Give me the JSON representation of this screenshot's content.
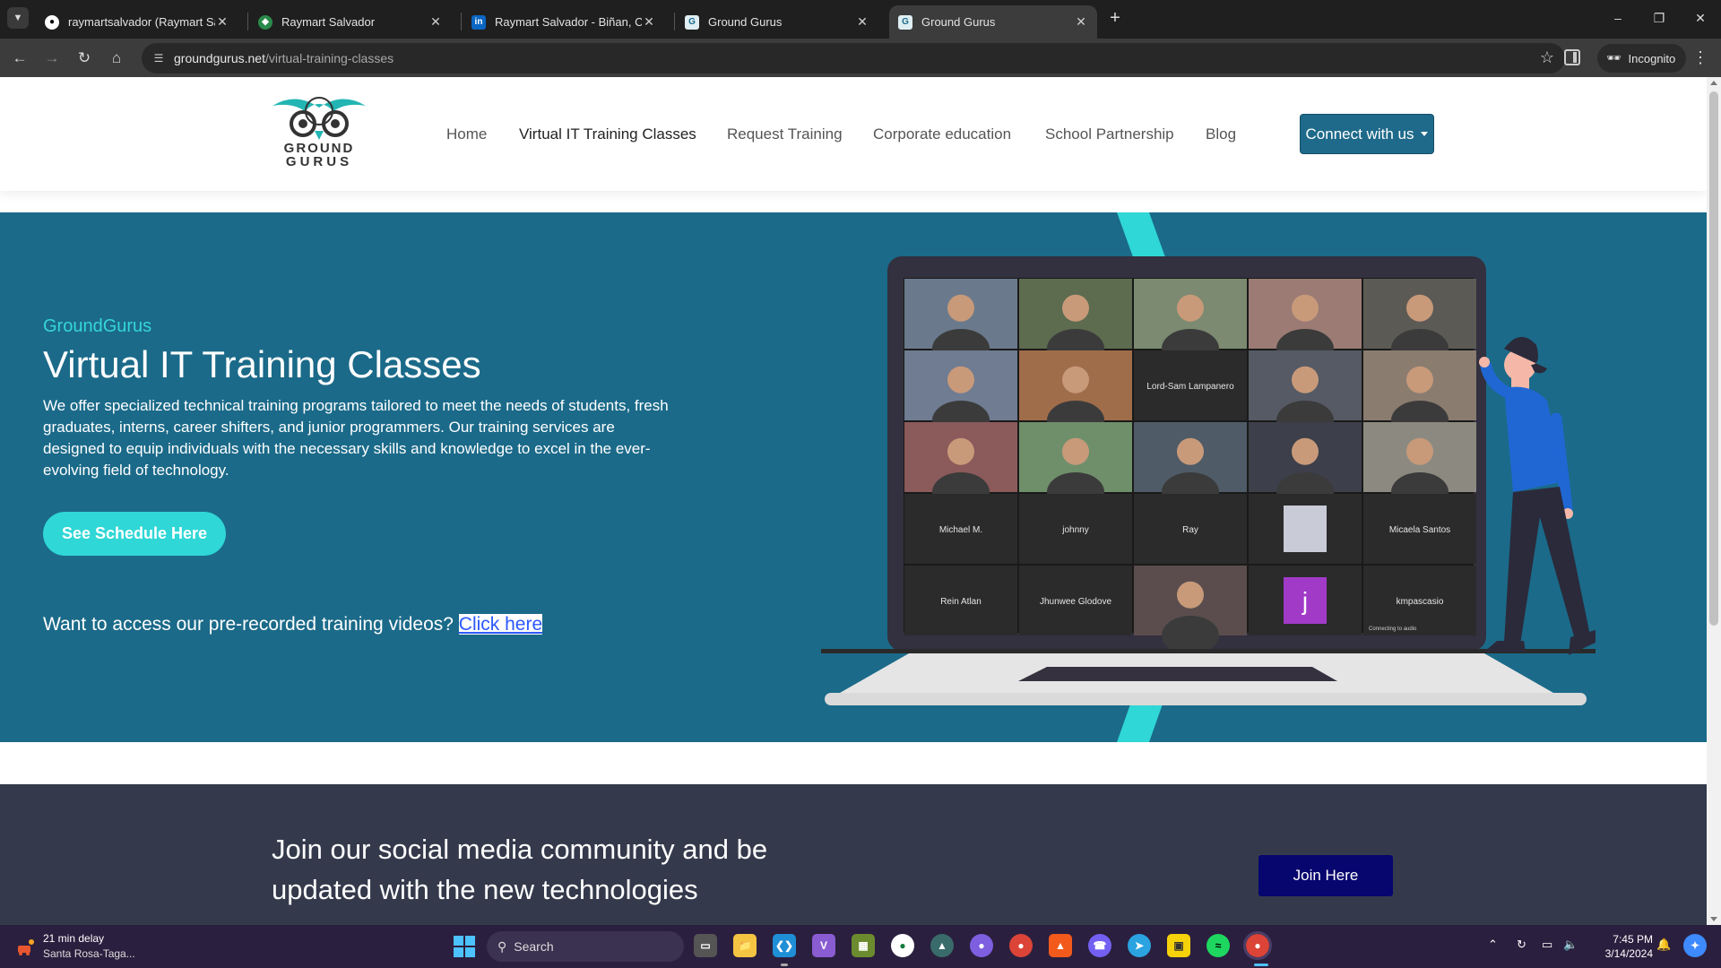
{
  "browser": {
    "tabs": [
      {
        "title": "raymartsalvador (Raymart Salva",
        "icon": "github-icon"
      },
      {
        "title": "Raymart Salvador",
        "icon": "site-icon"
      },
      {
        "title": "Raymart Salvador - Biñan, Calab",
        "icon": "linkedin-icon"
      },
      {
        "title": "Ground Gurus",
        "icon": "groundgurus-icon"
      },
      {
        "title": "Ground Gurus",
        "icon": "groundgurus-icon",
        "active": true
      }
    ],
    "new_tab": "+",
    "url_domain": "groundgurus.net",
    "url_path": "/virtual-training-classes",
    "incognito_label": "Incognito"
  },
  "site": {
    "logo_line1": "GROUND",
    "logo_line2": "GURUS",
    "nav": [
      "Home",
      "Virtual IT Training Classes",
      "Request Training",
      "Corporate education",
      "School Partnership",
      "Blog"
    ],
    "connect_label": "Connect with us"
  },
  "hero": {
    "brand": "GroundGurus",
    "title": "Virtual IT Training Classes",
    "description": "We offer specialized technical training programs tailored to meet the needs of students, fresh graduates, interns, career shifters, and junior programmers. Our training services are designed to equip individuals with the necessary skills and knowledge to excel in the ever-evolving field of technology.",
    "schedule_button": "See Schedule Here",
    "recorded_text": "Want to access our pre-recorded training videos?",
    "recorded_link": "Click here",
    "video_grid_names": [
      "Lord-Sam Lampanero",
      "Michael M.",
      "johnny",
      "Ray",
      "Micaela Santos",
      "Rein Atlan",
      "Jhunwee Glodove",
      "j",
      "kmpascasio"
    ],
    "video_status": "Connecting to audio"
  },
  "community": {
    "text": "Join our social media community and be updated with the new technologies",
    "join_button": "Join Here"
  },
  "taskbar": {
    "weather_title": "21 min delay",
    "weather_sub": "Santa Rosa-Taga...",
    "search_label": "Search",
    "time": "7:45 PM",
    "date": "3/14/2024"
  },
  "colors": {
    "hero_bg": "#1b6a89",
    "accent_teal": "#2fd7d6",
    "community_bg": "#343a4b",
    "join_button": "#07056e",
    "connect_button": "#1f6a8a"
  }
}
